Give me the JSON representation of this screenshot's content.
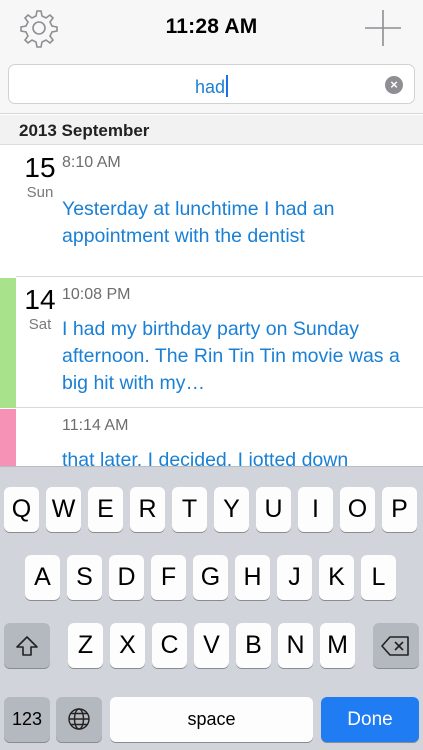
{
  "nav": {
    "title": "11:28 AM",
    "left_icon": "gear-icon",
    "right_icon": "plus-icon"
  },
  "search": {
    "value": "had"
  },
  "section": {
    "header": "2013 September"
  },
  "entries": [
    {
      "day": "15",
      "weekday": "Sun",
      "time": "8:10 AM",
      "text": "Yesterday at lunchtime I had an appointment with the dentist",
      "color": ""
    },
    {
      "day": "14",
      "weekday": "Sat",
      "time": "10:08 PM",
      "text": "I had my birthday party on Sunday afternoon. The Rin Tin Tin movie was a big hit with my…",
      "color": "#a8e28a"
    },
    {
      "day": "",
      "weekday": "",
      "time": "11:14 AM",
      "text": "that later. I decided. I jotted down",
      "color": "#f592b6"
    }
  ],
  "keyboard": {
    "row1": [
      "Q",
      "W",
      "E",
      "R",
      "T",
      "Y",
      "U",
      "I",
      "O",
      "P"
    ],
    "row2": [
      "A",
      "S",
      "D",
      "F",
      "G",
      "H",
      "J",
      "K",
      "L"
    ],
    "row3": [
      "Z",
      "X",
      "C",
      "V",
      "B",
      "N",
      "M"
    ],
    "numbers_label": "123",
    "space_label": "space",
    "done_label": "Done",
    "accent": "#1f7cf3"
  }
}
